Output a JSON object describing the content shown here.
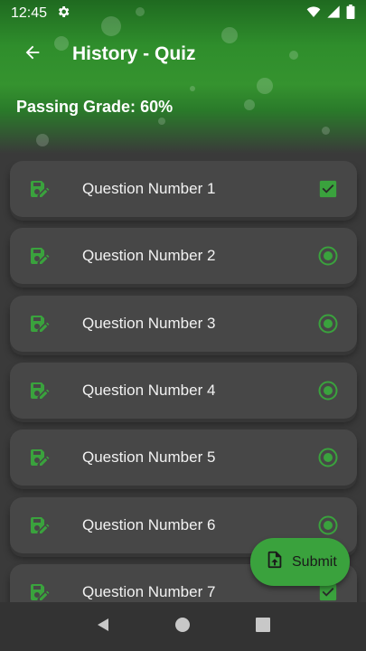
{
  "status_bar": {
    "time": "12:45",
    "icons": [
      "gear-icon",
      "wifi-icon",
      "signal-icon",
      "battery-icon"
    ]
  },
  "toolbar": {
    "title": "History - Quiz",
    "back_icon": "arrow-back-icon"
  },
  "passing": {
    "label": "Passing Grade:",
    "value": "60%"
  },
  "questions": [
    {
      "label": "Question Number 1",
      "state": "answered"
    },
    {
      "label": "Question Number 2",
      "state": "unanswered"
    },
    {
      "label": "Question Number 3",
      "state": "unanswered"
    },
    {
      "label": "Question Number 4",
      "state": "unanswered"
    },
    {
      "label": "Question Number 5",
      "state": "unanswered"
    },
    {
      "label": "Question Number 6",
      "state": "unanswered"
    },
    {
      "label": "Question Number 7",
      "state": "answered"
    }
  ],
  "submit": {
    "label": "Submit",
    "icon": "file-upload-icon"
  },
  "colors": {
    "accent": "#3aa23d",
    "card": "#474747",
    "background": "#3a3a3a"
  }
}
